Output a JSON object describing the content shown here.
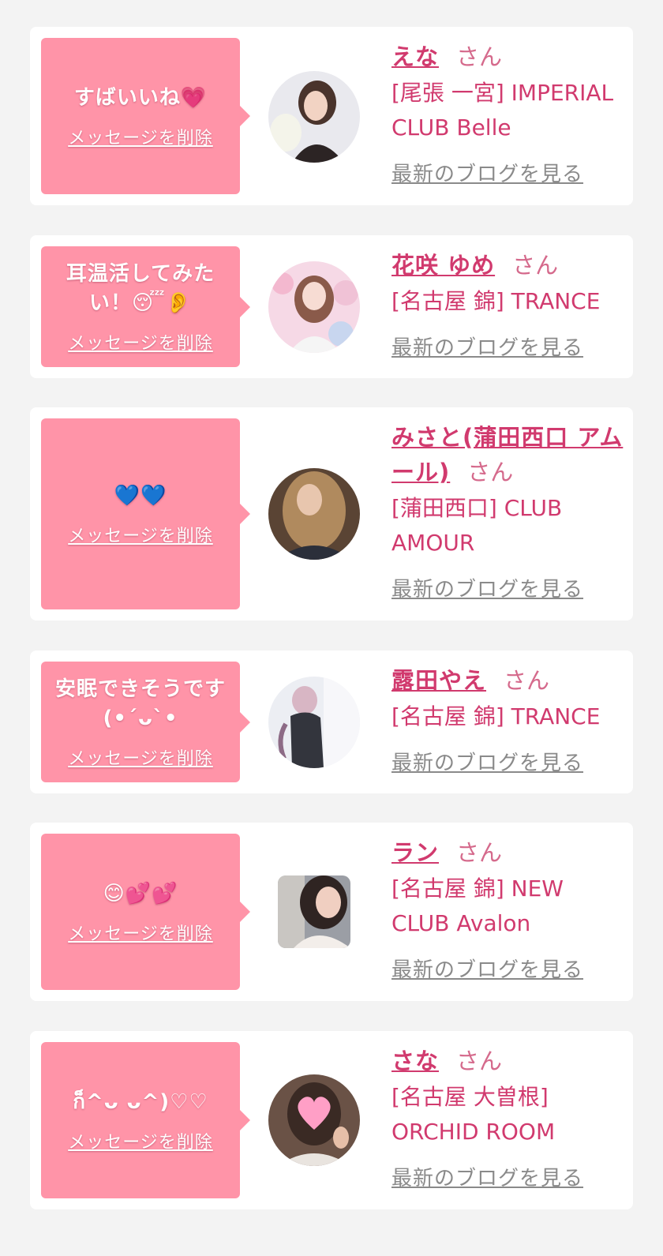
{
  "colors": {
    "page_background": "#f3f3f3",
    "card_background": "#ffffff",
    "bubble": "#ff94a8",
    "name_text": "#d13a6e",
    "blog_link": "#8a8a8a"
  },
  "delete_label": "メッセージを削除",
  "blog_label": "最新のブログを見る",
  "honorific": "さん",
  "entries": [
    {
      "message": "すばいいね💗",
      "name": "えな",
      "shop": "[尾張 一宮] IMPERIAL CLUB Belle",
      "avatar": "portrait-photo"
    },
    {
      "message": "耳温活してみたい！😴👂",
      "name": "花咲 ゆめ",
      "shop": "[名古屋 錦] TRANCE",
      "avatar": "portrait-photo"
    },
    {
      "message": "💙💙",
      "name": "みさと(蒲田西口 アムール)",
      "shop": "[蒲田西口] CLUB AMOUR",
      "avatar": "portrait-photo"
    },
    {
      "message": "安眠できそうです (•´ᴗ`•",
      "name": "露田やえ",
      "shop": "[名古屋 錦] TRANCE",
      "avatar": "portrait-photo"
    },
    {
      "message": "😊💕💕",
      "name": "ラン",
      "shop": "[名古屋 錦] NEW CLUB Avalon",
      "avatar": "portrait-photo"
    },
    {
      "message": "ก็^ᴗ ᴗ^)♡♡",
      "name": "さな",
      "shop": "[名古屋 大曽根] ORCHID ROOM",
      "avatar": "portrait-photo"
    }
  ]
}
